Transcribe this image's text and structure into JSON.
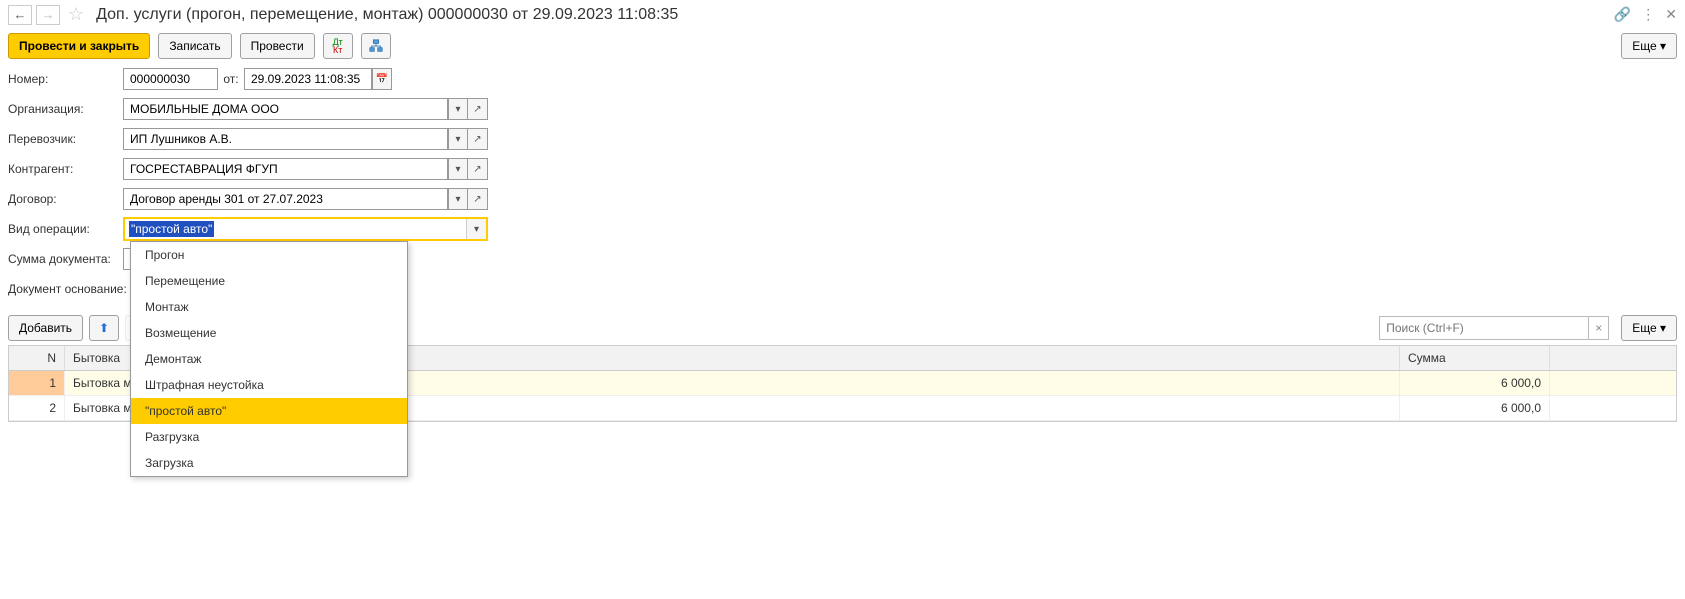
{
  "title": "Доп. услуги (прогон, перемещение, монтаж) 000000030 от 29.09.2023 11:08:35",
  "toolbar": {
    "post_close": "Провести и закрыть",
    "write": "Записать",
    "post": "Провести",
    "more": "Еще"
  },
  "form": {
    "number_label": "Номер:",
    "number_value": "000000030",
    "from_label": "от:",
    "date_value": "29.09.2023 11:08:35",
    "org_label": "Организация:",
    "org_value": "МОБИЛЬНЫЕ ДОМА ООО",
    "carrier_label": "Перевозчик:",
    "carrier_value": "ИП Лушников А.В.",
    "contragent_label": "Контрагент:",
    "contragent_value": "ГОСРЕСТАВРАЦИЯ ФГУП",
    "contract_label": "Договор:",
    "contract_value": "Договор аренды 301 от 27.07.2023",
    "optype_label": "Вид операции:",
    "optype_value": "\"простой авто\"",
    "docsum_label": "Сумма документа:",
    "docbase_label": "Документ основание:"
  },
  "dropdown": {
    "items": [
      {
        "label": "Прогон",
        "selected": false
      },
      {
        "label": "Перемещение",
        "selected": false
      },
      {
        "label": "Монтаж",
        "selected": false
      },
      {
        "label": "Возмещение",
        "selected": false
      },
      {
        "label": "Демонтаж",
        "selected": false
      },
      {
        "label": "Штрафная неустойка",
        "selected": false
      },
      {
        "label": "\"простой авто\"",
        "selected": true
      },
      {
        "label": "Разгрузка",
        "selected": false
      },
      {
        "label": "Загрузка",
        "selected": false
      }
    ]
  },
  "tablebar": {
    "add": "Добавить",
    "search_placeholder": "Поиск (Ctrl+F)",
    "more": "Еще"
  },
  "grid": {
    "headers": {
      "n": "N",
      "bytovka": "Бытовка",
      "sum": "Сумма"
    },
    "rows": [
      {
        "n": "1",
        "bytovka": "Бытовка м",
        "sum": "6 000,0",
        "highlight": true
      },
      {
        "n": "2",
        "bytovka": "Бытовка м",
        "sum": "6 000,0",
        "highlight": false
      }
    ]
  }
}
